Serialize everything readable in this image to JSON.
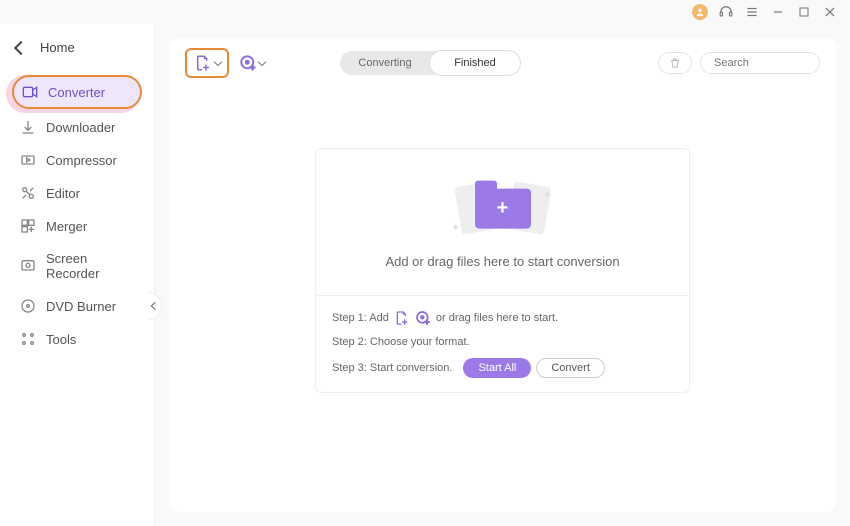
{
  "titlebar": {
    "avatar_color": "#f5b76a"
  },
  "sidebar": {
    "home_label": "Home",
    "items": [
      {
        "label": "Converter"
      },
      {
        "label": "Downloader"
      },
      {
        "label": "Compressor"
      },
      {
        "label": "Editor"
      },
      {
        "label": "Merger"
      },
      {
        "label": "Screen Recorder"
      },
      {
        "label": "DVD Burner"
      },
      {
        "label": "Tools"
      }
    ]
  },
  "toolbar": {
    "tabs": {
      "converting": "Converting",
      "finished": "Finished"
    },
    "search_placeholder": "Search"
  },
  "drop": {
    "main_text": "Add or drag files here to start conversion",
    "step1_pre": "Step 1: Add",
    "step1_post": "or drag files here to start.",
    "step2": "Step 2: Choose your format.",
    "step3": "Step 3: Start conversion.",
    "start_all": "Start All",
    "convert": "Convert"
  }
}
